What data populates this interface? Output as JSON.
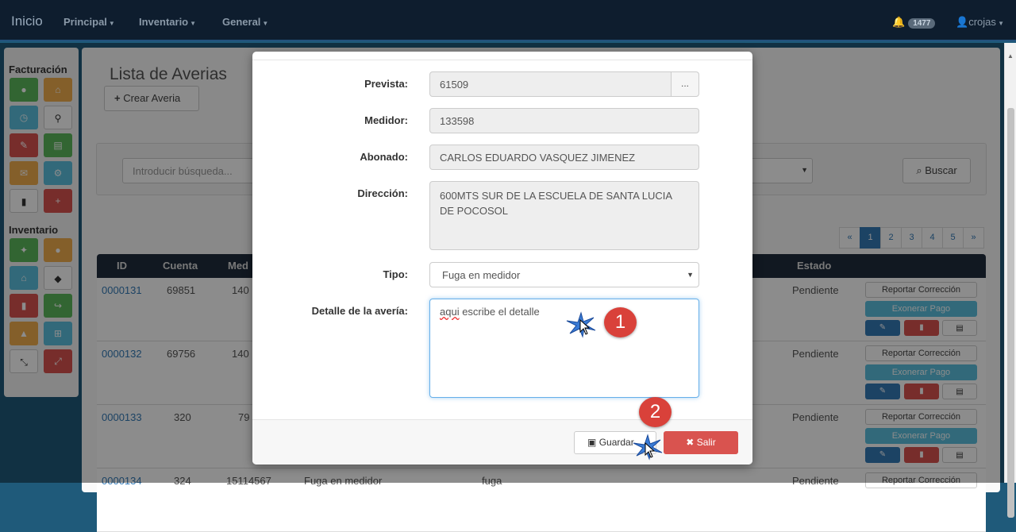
{
  "navbar": {
    "brand": "Inicio",
    "menus": [
      "Principal",
      "Inventario",
      "General"
    ],
    "notifications_count": "1477",
    "user": "crojas"
  },
  "sidebar": {
    "section1": "Facturación",
    "section2": "Inventario"
  },
  "page": {
    "title": "Lista de Averias",
    "create_button": "Crear Averia",
    "search_placeholder": "Introducir búsqueda...",
    "search_button": "Buscar"
  },
  "pagination": [
    "«",
    "1",
    "2",
    "3",
    "4",
    "5",
    "»"
  ],
  "table": {
    "headers": [
      "ID",
      "Cuenta",
      "Med",
      "Estado"
    ],
    "rows": [
      {
        "id": "0000131",
        "cuenta": "69851",
        "med": "140",
        "estado": "Pendiente"
      },
      {
        "id": "0000132",
        "cuenta": "69756",
        "med": "140",
        "estado": "Pendiente"
      },
      {
        "id": "0000133",
        "cuenta": "320",
        "med": "79",
        "estado": "Pendiente"
      },
      {
        "id": "0000134",
        "cuenta": "324",
        "med": "15114567",
        "tipo": "Fuga en medidor",
        "detalle": "fuga",
        "estado": "Pendiente"
      }
    ],
    "actions": {
      "report": "Reportar Corrección",
      "exonerate": "Exonerar Pago"
    }
  },
  "modal": {
    "prevista_label": "Prevista:",
    "prevista_value": "61509",
    "prevista_button": "...",
    "medidor_label": "Medidor:",
    "medidor_value": "133598",
    "abonado_label": "Abonado:",
    "abonado_value": "CARLOS EDUARDO VASQUEZ JIMENEZ",
    "direccion_label": "Dirección:",
    "direccion_value": "600MTS SUR DE LA ESCUELA DE SANTA LUCIA DE POCOSOL",
    "tipo_label": "Tipo:",
    "tipo_value": "Fuga en medidor",
    "detalle_label": "Detalle de la avería:",
    "detalle_value_word1": "aqui",
    "detalle_value_rest": " escribe el detalle",
    "save_button": "Guardar",
    "exit_button": "Salir"
  },
  "annotations": [
    "1",
    "2"
  ]
}
